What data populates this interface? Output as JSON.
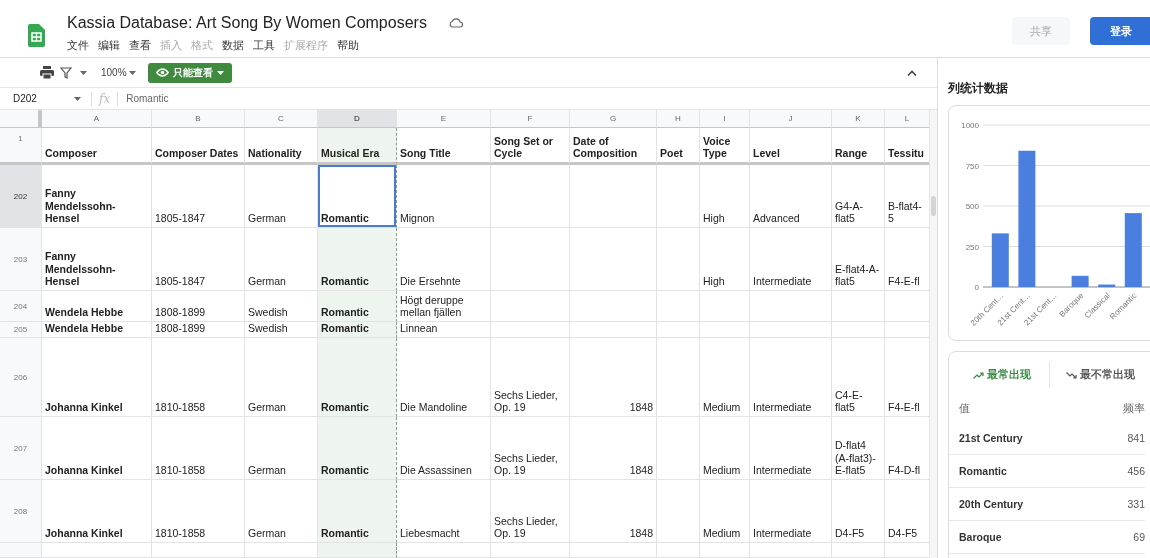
{
  "document": {
    "title": "Kassia Database: Art Song By Women Composers"
  },
  "menu": [
    {
      "label": "文件",
      "disabled": false
    },
    {
      "label": "编辑",
      "disabled": false
    },
    {
      "label": "查看",
      "disabled": false
    },
    {
      "label": "插入",
      "disabled": true
    },
    {
      "label": "格式",
      "disabled": true
    },
    {
      "label": "数据",
      "disabled": false
    },
    {
      "label": "工具",
      "disabled": false
    },
    {
      "label": "扩展程序",
      "disabled": true
    },
    {
      "label": "帮助",
      "disabled": false
    }
  ],
  "header_buttons": [
    {
      "label": "共享",
      "kind": "share",
      "disabled": true
    },
    {
      "label": "登录",
      "kind": "sign_in",
      "disabled": false
    }
  ],
  "toolbar": {
    "zoom": "100%",
    "view_mode": "只能查看"
  },
  "formula_bar": {
    "cell_ref": "D202",
    "fx": "fx",
    "value": "Romantic"
  },
  "sheet": {
    "columns": [
      {
        "letter": "A",
        "selected": false,
        "bold": true,
        "numeric": false
      },
      {
        "letter": "B",
        "selected": false,
        "bold": false,
        "numeric": false
      },
      {
        "letter": "C",
        "selected": false,
        "bold": false,
        "numeric": false
      },
      {
        "letter": "D",
        "selected": true,
        "bold": true,
        "numeric": false
      },
      {
        "letter": "E",
        "selected": false,
        "bold": false,
        "numeric": false
      },
      {
        "letter": "F",
        "selected": false,
        "bold": false
      },
      {
        "letter": "G",
        "selected": false,
        "bold": false,
        "numeric": true
      },
      {
        "letter": "H",
        "selected": false,
        "bold": false
      },
      {
        "letter": "I",
        "selected": false,
        "bold": false,
        "numeric": false
      },
      {
        "letter": "J",
        "selected": false,
        "bold": false,
        "numeric": false
      },
      {
        "letter": "K",
        "selected": false,
        "bold": false,
        "numeric": false
      },
      {
        "letter": "L",
        "selected": false,
        "bold": false,
        "numeric": false
      }
    ],
    "rows": [
      {
        "number": "1",
        "kind": "header",
        "selected": false,
        "cells": [
          "Composer",
          "Composer Dates",
          "Nationality",
          "Musical Era",
          "Song Title",
          "Song Set or Cycle",
          "Date of Composition",
          "Poet",
          "Voice Type",
          "Level",
          "Range",
          "Tessitu"
        ]
      },
      {
        "number": "202",
        "kind": "data",
        "selected": true,
        "cells": [
          "Fanny Mendelssohn-Hensel",
          "1805-1847",
          "German",
          "Romantic",
          "Mignon",
          null,
          null,
          null,
          "High",
          "Advanced",
          "G4-A-flat5",
          "B-flat4-5"
        ]
      },
      {
        "number": "203",
        "kind": "data",
        "selected": false,
        "cells": [
          "Fanny Mendelssohn-Hensel",
          "1805-1847",
          "German",
          "Romantic",
          "Die Ersehnte",
          null,
          null,
          null,
          "High",
          "Intermediate",
          "E-flat4-A-flat5",
          "F4-E-fl"
        ]
      },
      {
        "number": "204",
        "kind": "data",
        "selected": false,
        "cells": [
          "Wendela Hebbe",
          "1808-1899",
          "Swedish",
          "Romantic",
          "Högt deruppe mellan fjällen",
          null,
          null,
          null,
          null,
          null,
          null,
          null
        ]
      },
      {
        "number": "205",
        "kind": "data",
        "selected": false,
        "cells": [
          "Wendela Hebbe",
          "1808-1899",
          "Swedish",
          "Romantic",
          "Linnean",
          null,
          null,
          null,
          null,
          null,
          null,
          null
        ]
      },
      {
        "number": "206",
        "kind": "data",
        "selected": false,
        "cells": [
          "Johanna Kinkel",
          "1810-1858",
          "German",
          "Romantic",
          "Die Mandoline",
          "Sechs Lieder, Op. 19",
          "1848",
          null,
          "Medium",
          "Intermediate",
          "C4-E-flat5",
          "F4-E-fl"
        ]
      },
      {
        "number": "207",
        "kind": "data",
        "selected": false,
        "cells": [
          "Johanna Kinkel",
          "1810-1858",
          "German",
          "Romantic",
          "Die Assassinen",
          "Sechs Lieder, Op. 19",
          "1848",
          null,
          "Medium",
          "Intermediate",
          "D-flat4 (A-flat3)-E-flat5",
          "F4-D-fl"
        ]
      },
      {
        "number": "208",
        "kind": "data",
        "selected": false,
        "cells": [
          "Johanna Kinkel",
          "1810-1858",
          "German",
          "Romantic",
          "Liebesmacht",
          "Sechs Lieder, Op. 19",
          "1848",
          null,
          "Medium",
          "Intermediate",
          "D4-F5",
          "D4-F5"
        ]
      }
    ]
  },
  "panel": {
    "title": "列统计数据",
    "chart_data": {
      "type": "bar",
      "categories": [
        "20th Cent…",
        "21st Cent…",
        "21st Cent…",
        "Baroque",
        "Classical",
        "Romantic"
      ],
      "values": [
        331,
        841,
        0,
        69,
        15,
        456
      ],
      "ylim": [
        0,
        1000
      ],
      "yticks": [
        0,
        250,
        500,
        750,
        1000
      ],
      "grid": true
    },
    "frequency": {
      "tabs": [
        {
          "label": "最常出现",
          "kind": "up",
          "selected": true
        },
        {
          "label": "最不常出现",
          "kind": "down",
          "selected": false
        }
      ],
      "columns": [
        "值",
        "频率"
      ],
      "rows": [
        {
          "value": "21st Century",
          "count": "841"
        },
        {
          "value": "Romantic",
          "count": "456"
        },
        {
          "value": "20th Century",
          "count": "331"
        },
        {
          "value": "Baroque",
          "count": "69"
        }
      ]
    }
  }
}
